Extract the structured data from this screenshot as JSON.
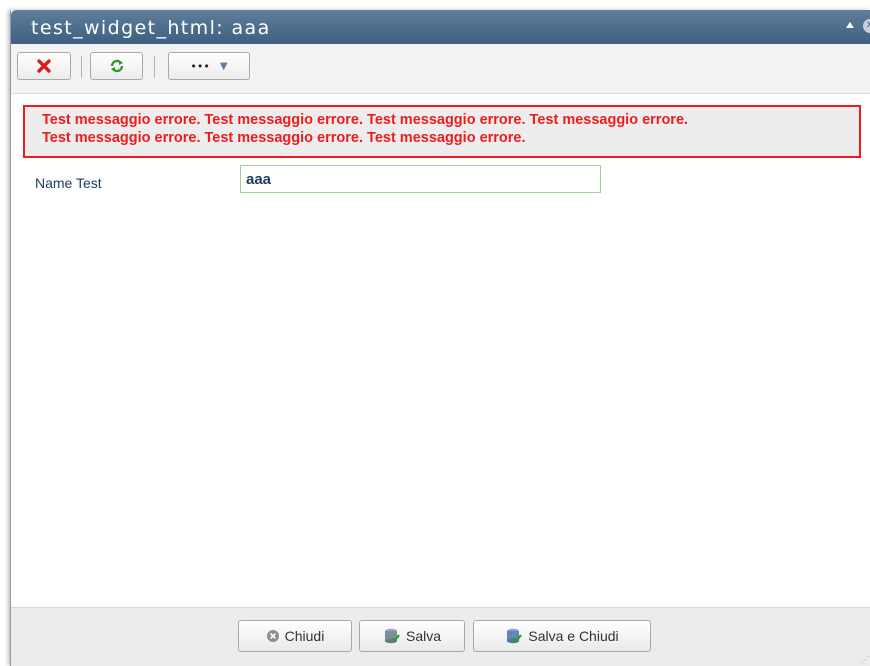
{
  "window": {
    "title": "test_widget_html: aaa",
    "minimize_glyph": "▲",
    "close_glyph": "✕"
  },
  "toolbar": {
    "close_icon": "red-x-icon",
    "refresh_icon": "green-refresh-icon",
    "more_glyph": "•••",
    "more_caret": "▼"
  },
  "error": {
    "line1": "Test messaggio errore. Test messaggio errore. Test messaggio errore. Test messaggio errore.",
    "line2": "Test messaggio errore. Test messaggio errore. Test messaggio errore."
  },
  "form": {
    "name_label": "Name Test",
    "name_value": "aaa"
  },
  "footer": {
    "chiudi_label": "Chiudi",
    "salva_label": "Salva",
    "salva_chiudi_label": "Salva e Chiudi"
  },
  "colors": {
    "error": "#ee1c1c",
    "titlebar": "#4a6a8c",
    "label_text": "#1f3c66",
    "input_border": "#9fd39a"
  }
}
